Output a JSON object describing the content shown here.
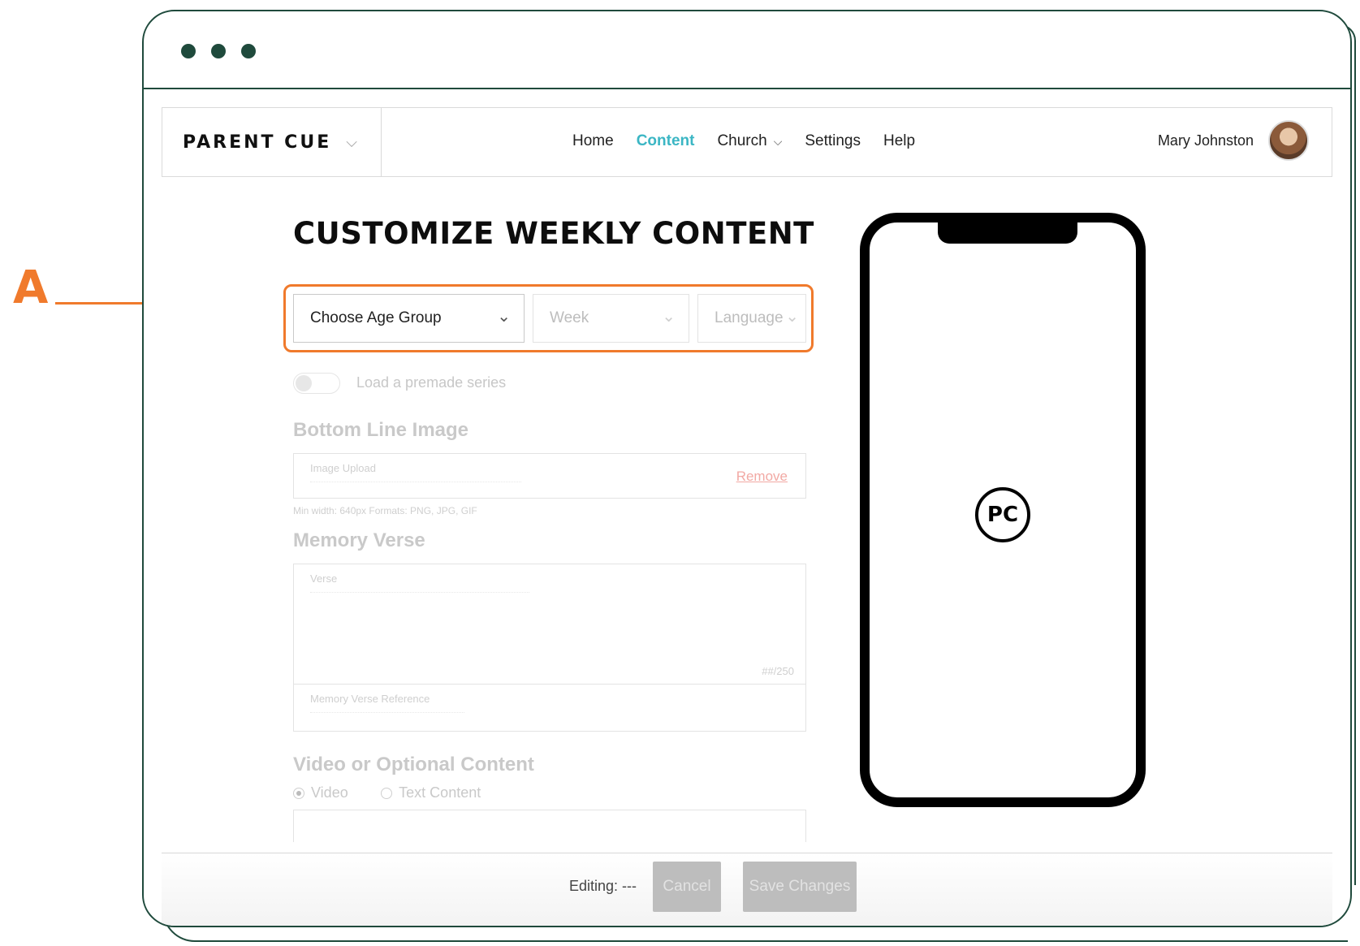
{
  "annotation": {
    "letter": "A"
  },
  "brand": {
    "name": "PARENT CUE"
  },
  "nav": {
    "home": "Home",
    "content": "Content",
    "church": "Church",
    "settings": "Settings",
    "help": "Help"
  },
  "user": {
    "name": "Mary Johnston"
  },
  "page": {
    "title": "CUSTOMIZE WEEKLY CONTENT"
  },
  "filters": {
    "age_group": "Choose Age Group",
    "week": "Week",
    "language": "Language"
  },
  "premade": {
    "label": "Load a premade series"
  },
  "bottom_line": {
    "heading": "Bottom Line Image",
    "upload_label": "Image Upload",
    "remove": "Remove",
    "hint": "Min width: 640px    Formats: PNG, JPG, GIF"
  },
  "memory_verse": {
    "heading": "Memory Verse",
    "verse_label": "Verse",
    "counter": "##/250",
    "reference_label": "Memory Verse Reference"
  },
  "optional": {
    "heading": "Video or Optional Content",
    "video": "Video",
    "text": "Text Content"
  },
  "editbar": {
    "editing": "Editing: ---",
    "cancel": "Cancel",
    "save": "Save Changes"
  },
  "phone": {
    "logo": "PC"
  },
  "colors": {
    "frame": "#1f4a3c",
    "accent": "#3bb6c4",
    "annotation": "#f07a2c",
    "remove": "#f2a9a4"
  }
}
